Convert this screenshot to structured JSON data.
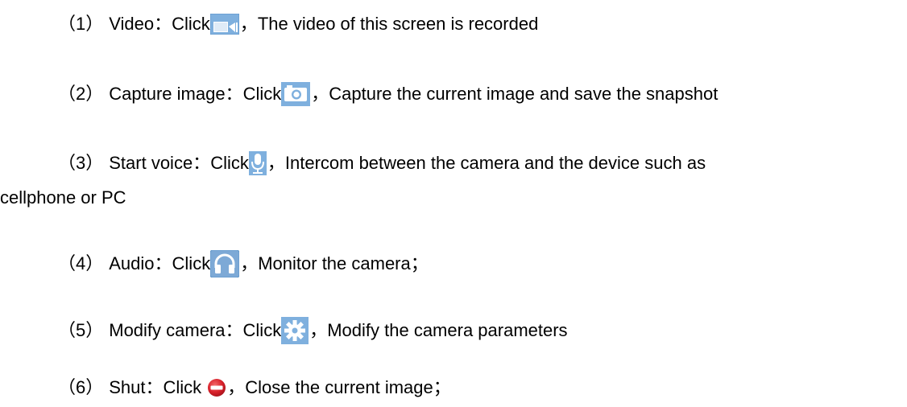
{
  "items": [
    {
      "number": "（1）",
      "name": "Video：",
      "click": "Click",
      "icon": "video-camera-icon",
      "sep": "，",
      "desc": "The video of this screen is recorded"
    },
    {
      "number": "（2）",
      "name": "Capture image：",
      "click": "Click",
      "icon": "camera-icon",
      "sep": "，",
      "desc": "Capture the current image and save the snapshot"
    },
    {
      "number": "（3）",
      "name": "Start voice：",
      "click": "Click",
      "icon": "microphone-icon",
      "sep": "，",
      "desc": "Intercom between the camera and the device such as",
      "desc_cont": "cellphone or PC"
    },
    {
      "number": "（4）",
      "name": "Audio：",
      "click": "Click",
      "icon": "headphones-icon",
      "sep": "，",
      "desc": "Monitor the camera；"
    },
    {
      "number": "（5）",
      "name": "Modify camera：",
      "click": "Click",
      "icon": "gear-icon",
      "sep": "，",
      "desc": "Modify the camera parameters"
    },
    {
      "number": "（6）",
      "name": "Shut：",
      "click": "Click",
      "icon": "close-stop-icon",
      "sep": "，",
      "desc": "Close the current image；"
    }
  ],
  "colors": {
    "icon_blue": "#7fb0de",
    "icon_blue_dark": "#5d95c9",
    "stop_red": "#d8202a",
    "text": "#000000"
  }
}
